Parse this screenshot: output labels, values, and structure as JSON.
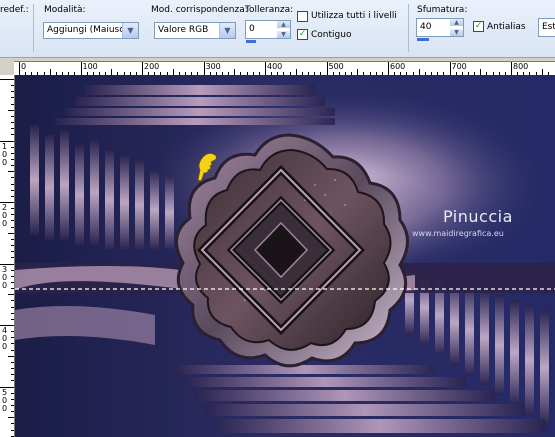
{
  "toolbar": {
    "preset_label": "redef.:",
    "mode_label": "Modalità:",
    "mode_value": "Aggiungi (Maiusc)",
    "match_label": "Mod. corrispondenza:",
    "match_value": "Valore RGB",
    "tolerance_label": "Tolleranza:",
    "tolerance_value": "0",
    "use_all_layers_label": "Utilizza tutti i livelli",
    "use_all_layers_checked": false,
    "contiguous_label": "Contiguo",
    "contiguous_checked": true,
    "feather_label": "Sfumatura:",
    "feather_value": "40",
    "antialias_label": "Antialias",
    "antialias_checked": true,
    "extra_combo_value": "Est"
  },
  "ruler": {
    "h_labels": [
      "0",
      "100",
      "200",
      "300",
      "400",
      "500",
      "600",
      "700",
      "800"
    ],
    "v_labels": [
      "1\n0\n0",
      "2\n0\n0",
      "3\n0\n0",
      "4\n0\n0",
      "5\n0\n0"
    ]
  },
  "canvas": {
    "watermark_title": "Pinuccia",
    "watermark_url": "www.maidiregrafica.eu"
  }
}
